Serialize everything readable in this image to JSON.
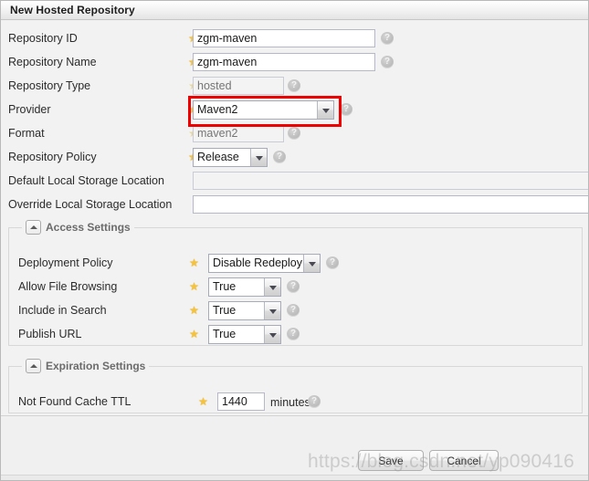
{
  "window": {
    "title": "New Hosted Repository"
  },
  "fields": [
    {
      "label": "Repository ID",
      "value": "zgm-maven",
      "placeholder": "",
      "type": "text",
      "required": true,
      "disabled": false,
      "help": true
    },
    {
      "label": "Repository Name",
      "value": "zgm-maven",
      "placeholder": "",
      "type": "text",
      "required": true,
      "disabled": false,
      "help": true
    },
    {
      "label": "Repository Type",
      "value": "",
      "placeholder": "hosted",
      "type": "text",
      "required": true,
      "disabled": true,
      "help": true
    },
    {
      "label": "Provider",
      "value": "Maven2",
      "placeholder": "",
      "type": "dropdown",
      "required": true,
      "disabled": false,
      "help": true
    },
    {
      "label": "Format",
      "value": "",
      "placeholder": "maven2",
      "type": "text",
      "required": true,
      "disabled": true,
      "help": true
    },
    {
      "label": "Repository Policy",
      "value": "Release",
      "placeholder": "",
      "type": "dropdown",
      "required": true,
      "disabled": false,
      "help": true
    },
    {
      "label": "Default Local Storage Location",
      "value": "",
      "placeholder": "",
      "type": "text",
      "required": false,
      "disabled": true,
      "help": false
    },
    {
      "label": "Override Local Storage Location",
      "value": "",
      "placeholder": "",
      "type": "text",
      "required": false,
      "disabled": false,
      "help": false
    }
  ],
  "access_settings": {
    "legend": "Access Settings",
    "fields": [
      {
        "label": "Deployment Policy",
        "value": "Disable Redeploy",
        "type": "dropdown",
        "required": true,
        "help": true
      },
      {
        "label": "Allow File Browsing",
        "value": "True",
        "type": "dropdown",
        "required": true,
        "help": true
      },
      {
        "label": "Include in Search",
        "value": "True",
        "type": "dropdown",
        "required": true,
        "help": true
      },
      {
        "label": "Publish URL",
        "value": "True",
        "type": "dropdown",
        "required": true,
        "help": true
      }
    ]
  },
  "expiration_settings": {
    "legend": "Expiration Settings",
    "fields": [
      {
        "label": "Not Found Cache TTL",
        "value": "1440",
        "units": "minutes",
        "type": "text",
        "required": true,
        "help": true
      }
    ]
  },
  "footer": {
    "save_label": "Save",
    "cancel_label": "Cancel"
  },
  "annotation": {
    "color": "#ef0000",
    "target": "Provider"
  },
  "watermark": {
    "text": "https://blog.csdn.net/yp090416"
  }
}
